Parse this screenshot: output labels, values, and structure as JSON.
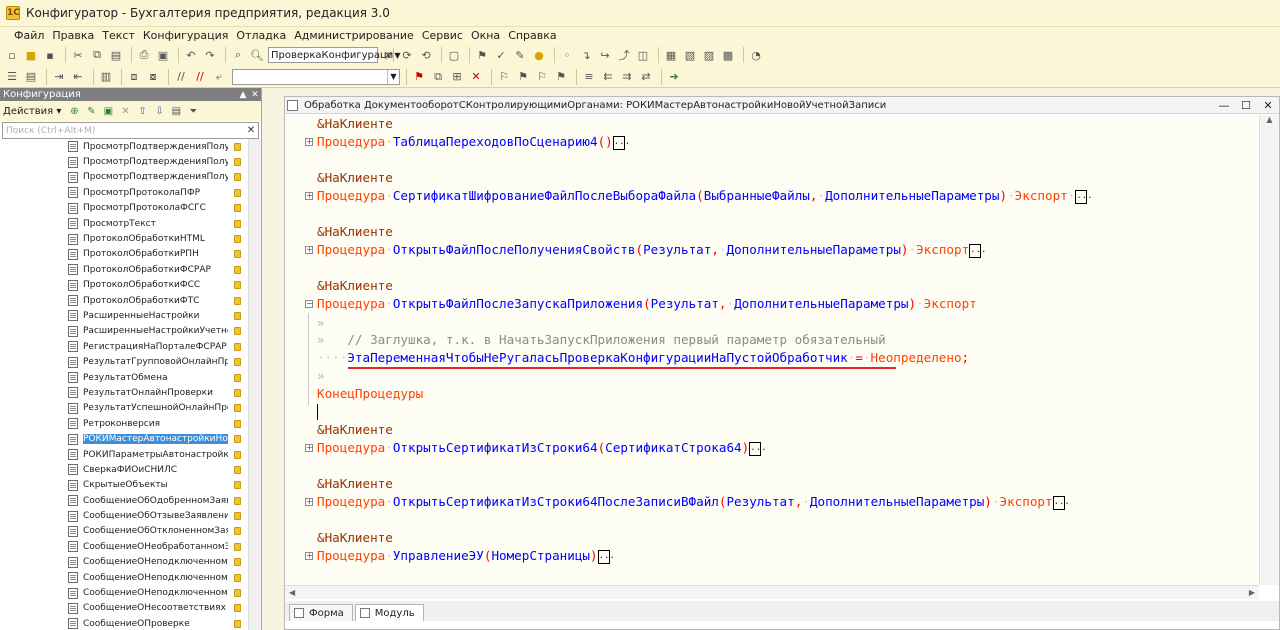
{
  "window": {
    "title": "Конфигуратор - Бухгалтерия предприятия, редакция 3.0"
  },
  "menu": [
    "Файл",
    "Правка",
    "Текст",
    "Конфигурация",
    "Отладка",
    "Администрирование",
    "Сервис",
    "Окна",
    "Справка"
  ],
  "toolbar": {
    "search_value": "ПроверкаКонфигураци"
  },
  "left_panel": {
    "title": "Конфигурация",
    "actions_label": "Действия",
    "search_placeholder": "Поиск (Ctrl+Alt+M)",
    "items": [
      "ПросмотрПодтвержденияПолуч...",
      "ПросмотрПодтвержденияПолуч...",
      "ПросмотрПодтвержденияПолуч...",
      "ПросмотрПротоколаПФР",
      "ПросмотрПротоколаФСГС",
      "ПросмотрТекст",
      "ПротоколОбработкиHTML",
      "ПротоколОбработкиРПН",
      "ПротоколОбработкиФСРАР",
      "ПротоколОбработкиФСС",
      "ПротоколОбработкиФТС",
      "РасширенныеНастройки",
      "РасширенныеНастройкиУчетно...",
      "РегистрацияНаПорталеФСРАР",
      "РезультатГрупповойОнлайнПро...",
      "РезультатОбмена",
      "РезультатОнлайнПроверки",
      "РезультатУспешнойОнлайнПро...",
      "Ретроконверсия",
      "РОКИМастерАвтонастройкиНо...",
      "РОКИПараметрыАвтонастройк...",
      "СверкаФИОиСНИЛС",
      "СкрытыеОбъекты",
      "СообщениеОбОдобренномЗаяв...",
      "СообщениеОбОтзывеЗаявления",
      "СообщениеОбОтклоненномЗая...",
      "СообщениеОНеобработанномЗ...",
      "СообщениеОНеподключенномН...",
      "СообщениеОНеподключенномН...",
      "СообщениеОНеподключенномН...",
      "СообщениеОНесоответствиях",
      "СообщениеОПроверке"
    ],
    "selected_index": 19
  },
  "editor": {
    "title": "Обработка ДокументооборотСКонтролирующимиОрганами: РОКИМастерАвтонастройкиНовойУчетнойЗаписи",
    "lines": {
      "l1_dir": "&НаКлиенте",
      "l2_kw": "Процедура",
      "l2_name": "ТаблицаПереходовПоСценарию4",
      "l2_paren": "()",
      "l3_dir": "&НаКлиенте",
      "l4_kw": "Процедура",
      "l4_name": "СертификатШифрованиеФайлПослеВыбораФайла",
      "l4_p1": "ВыбранныеФайлы",
      "l4_p2": "ДополнительныеПараметры",
      "l4_export": "Экспорт",
      "l5_dir": "&НаКлиенте",
      "l6_kw": "Процедура",
      "l6_name": "ОткрытьФайлПослеПолученияСвойств",
      "l6_p1": "Результат",
      "l6_p2": "ДополнительныеПараметры",
      "l6_export": "Экспорт",
      "l7_dir": "&НаКлиенте",
      "l8_kw": "Процедура",
      "l8_name": "ОткрытьФайлПослеЗапускаПриложения",
      "l8_p1": "Результат",
      "l8_p2": "ДополнительныеПараметры",
      "l8_export": "Экспорт",
      "l9_comment": "// Заглушка, т.к. в НачатьЗапускПриложения первый параметр обязательный",
      "l10_var": "ЭтаПеременнаяЧтобыНеРугаласьПроверкаКонфигурацииНаПустойОбработчик",
      "l10_eq": "=",
      "l10_val": "Неопределено",
      "l11_end": "КонецПроцедуры",
      "l12_dir": "&НаКлиенте",
      "l13_kw": "Процедура",
      "l13_name": "ОткрытьСертификатИзСтроки64",
      "l13_p1": "СертификатСтрока64",
      "l14_dir": "&НаКлиенте",
      "l15_kw": "Процедура",
      "l15_name": "ОткрытьСертификатИзСтроки64ПослеЗаписиВФайл",
      "l15_p1": "Результат",
      "l15_p2": "ДополнительныеПараметры",
      "l15_export": "Экспорт",
      "l16_dir": "&НаКлиенте",
      "l17_kw": "Процедура",
      "l17_name": "УправлениеЭУ",
      "l17_p1": "НомерСтраницы"
    },
    "tabs": [
      "Форма",
      "Модуль"
    ],
    "active_tab": 1
  },
  "colors": {
    "directive": "#963200",
    "keyword": "#ff4200",
    "identifier": "#0000ff",
    "highlight_underline": "#e0262b",
    "selection": "#3e8ed8"
  }
}
